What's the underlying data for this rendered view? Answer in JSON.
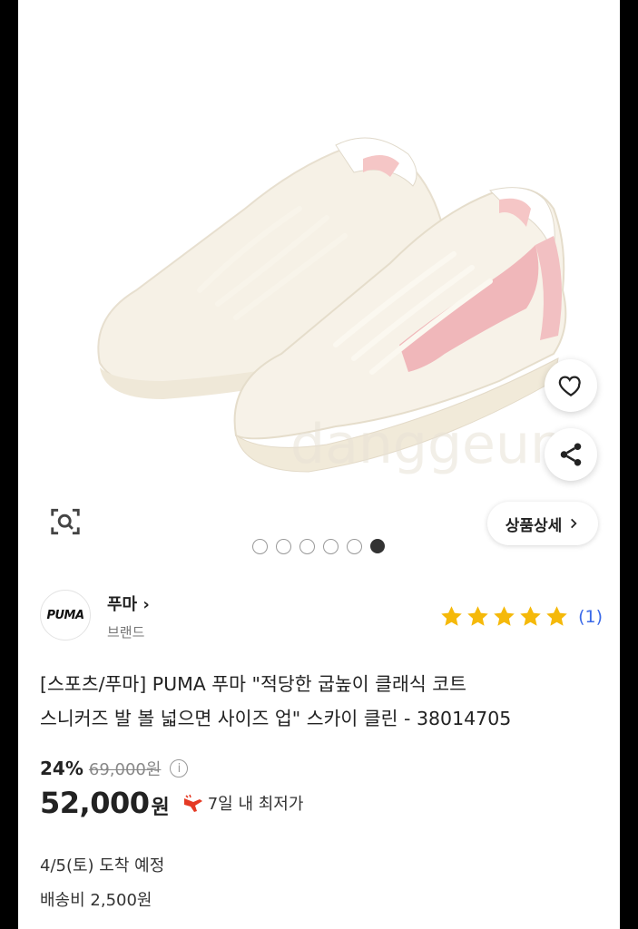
{
  "product_gallery": {
    "image_description": "Pink and cream Puma sneakers",
    "watermark": "danggeun",
    "detail_button_label": "상품상세",
    "page_count": 6,
    "active_page": 6
  },
  "brand": {
    "logo_text": "PUMA",
    "name": "푸마",
    "sub_label": "브랜드"
  },
  "rating": {
    "stars": 5,
    "count": "(1)",
    "star_color": "#f5b90a"
  },
  "product": {
    "title_line1": "[스포츠/푸마] PUMA 푸마 \"적당한 굽높이 클래식 코트",
    "title_line2": "스니커즈 발 볼 넓으면 사이즈 업\" 스카이 클린 - 38014705"
  },
  "price": {
    "discount": "24%",
    "original": "69,000원",
    "current": "52,000",
    "unit": "원",
    "lowest_label": "7일 내 최저가",
    "accent_color": "#e53a24"
  },
  "delivery": {
    "arrival": "4/5(토) 도착 예정",
    "shipping": "배송비 2,500원"
  },
  "icons": [
    "heart-icon",
    "share-icon",
    "zoom-search-icon",
    "chevron-right-icon",
    "info-icon",
    "hand-pointer-icon"
  ]
}
